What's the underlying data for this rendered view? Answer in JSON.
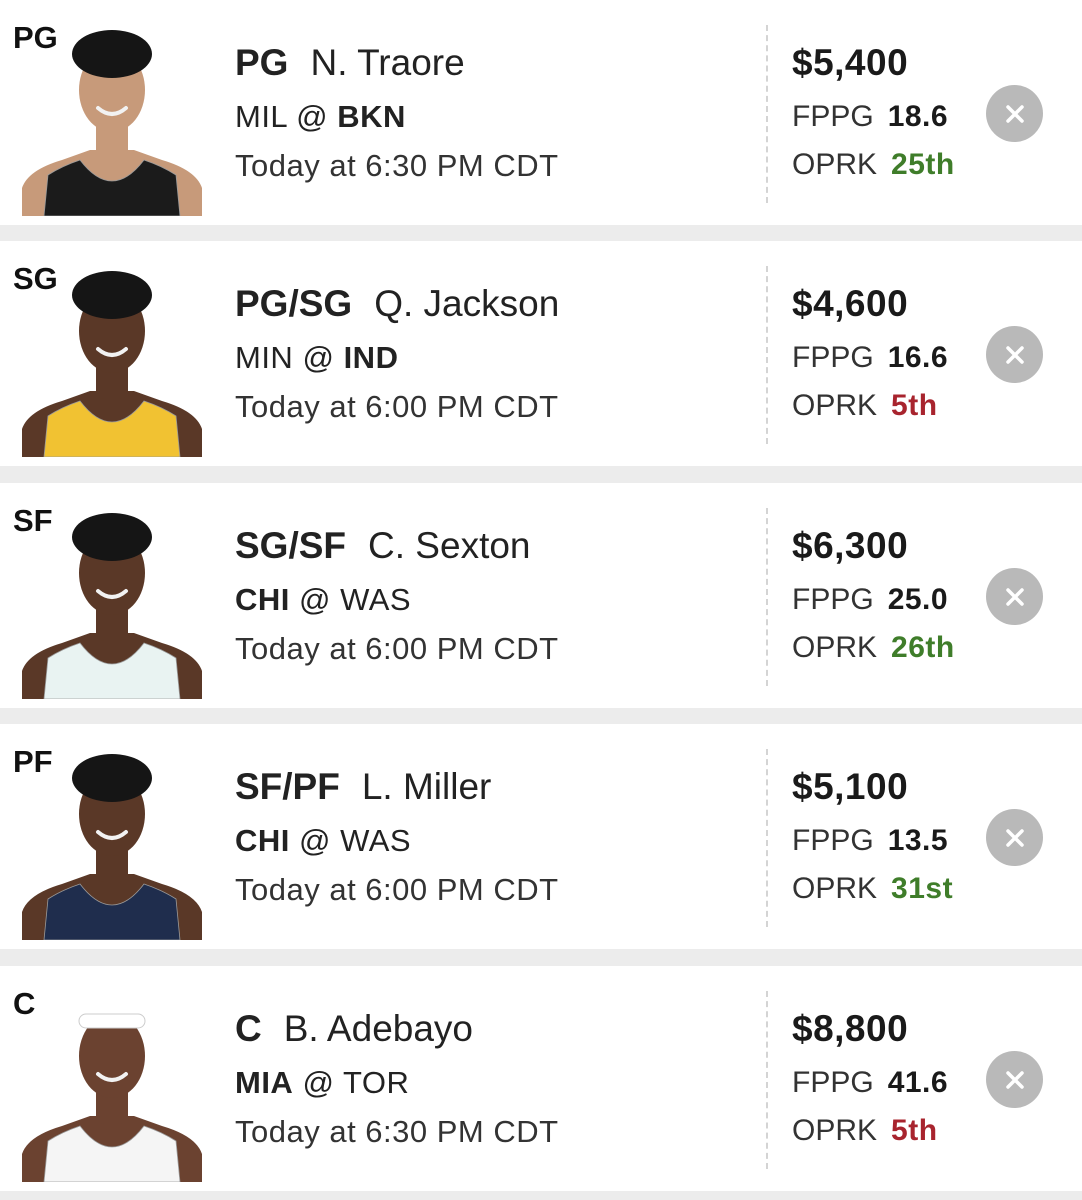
{
  "roster": [
    {
      "slot": "PG",
      "positions": "PG",
      "name": "N. Traore",
      "away": "MIL",
      "at": "@",
      "home": "BKN",
      "bold_team": "home",
      "time": "Today at 6:30 PM CDT",
      "salary": "$5,400",
      "fppg_label": "FPPG",
      "fppg": "18.6",
      "oprk_label": "OPRK",
      "oprk": "25th",
      "oprk_color": "#3f7d2a",
      "jersey_color": "#1b1b1b",
      "remove_icon": "close-icon"
    },
    {
      "slot": "SG",
      "positions": "PG/SG",
      "name": "Q. Jackson",
      "away": "MIN",
      "at": "@",
      "home": "IND",
      "bold_team": "home",
      "time": "Today at 6:00 PM CDT",
      "salary": "$4,600",
      "fppg_label": "FPPG",
      "fppg": "16.6",
      "oprk_label": "OPRK",
      "oprk": "5th",
      "oprk_color": "#a8242e",
      "jersey_color": "#f1c232",
      "remove_icon": "close-icon"
    },
    {
      "slot": "SF",
      "positions": "SG/SF",
      "name": "C. Sexton",
      "away": "CHI",
      "at": "@",
      "home": "WAS",
      "bold_team": "away",
      "time": "Today at 6:00 PM CDT",
      "salary": "$6,300",
      "fppg_label": "FPPG",
      "fppg": "25.0",
      "oprk_label": "OPRK",
      "oprk": "26th",
      "oprk_color": "#3f7d2a",
      "jersey_color": "#e9f3f2",
      "remove_icon": "close-icon"
    },
    {
      "slot": "PF",
      "positions": "SF/PF",
      "name": "L. Miller",
      "away": "CHI",
      "at": "@",
      "home": "WAS",
      "bold_team": "away",
      "time": "Today at 6:00 PM CDT",
      "salary": "$5,100",
      "fppg_label": "FPPG",
      "fppg": "13.5",
      "oprk_label": "OPRK",
      "oprk": "31st",
      "oprk_color": "#3f7d2a",
      "jersey_color": "#1f2d4d",
      "remove_icon": "close-icon"
    },
    {
      "slot": "C",
      "positions": "C",
      "name": "B. Adebayo",
      "away": "MIA",
      "at": "@",
      "home": "TOR",
      "bold_team": "away",
      "time": "Today at 6:30 PM CDT",
      "salary": "$8,800",
      "fppg_label": "FPPG",
      "fppg": "41.6",
      "oprk_label": "OPRK",
      "oprk": "5th",
      "oprk_color": "#a8242e",
      "jersey_color": "#f5f5f5",
      "remove_icon": "close-icon"
    }
  ]
}
